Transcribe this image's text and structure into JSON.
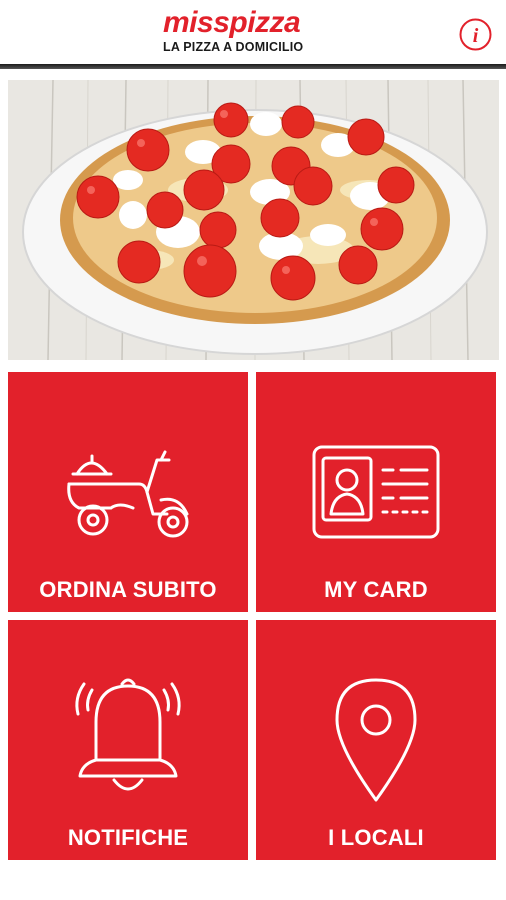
{
  "header": {
    "logo_text": "misspizza",
    "tagline": "LA PIZZA A DOMICILIO",
    "info_icon": "info-icon"
  },
  "hero": {
    "icon": "pizza-photo"
  },
  "tiles": [
    {
      "label": "ORDINA SUBITO",
      "icon": "scooter-delivery-icon"
    },
    {
      "label": "MY CARD",
      "icon": "id-card-icon"
    },
    {
      "label": "NOTIFICHE",
      "icon": "bell-icon"
    },
    {
      "label": "I LOCALI",
      "icon": "location-pin-icon"
    }
  ],
  "colors": {
    "brand_red": "#e2212b",
    "white": "#ffffff",
    "dark": "#1a1a1a"
  }
}
